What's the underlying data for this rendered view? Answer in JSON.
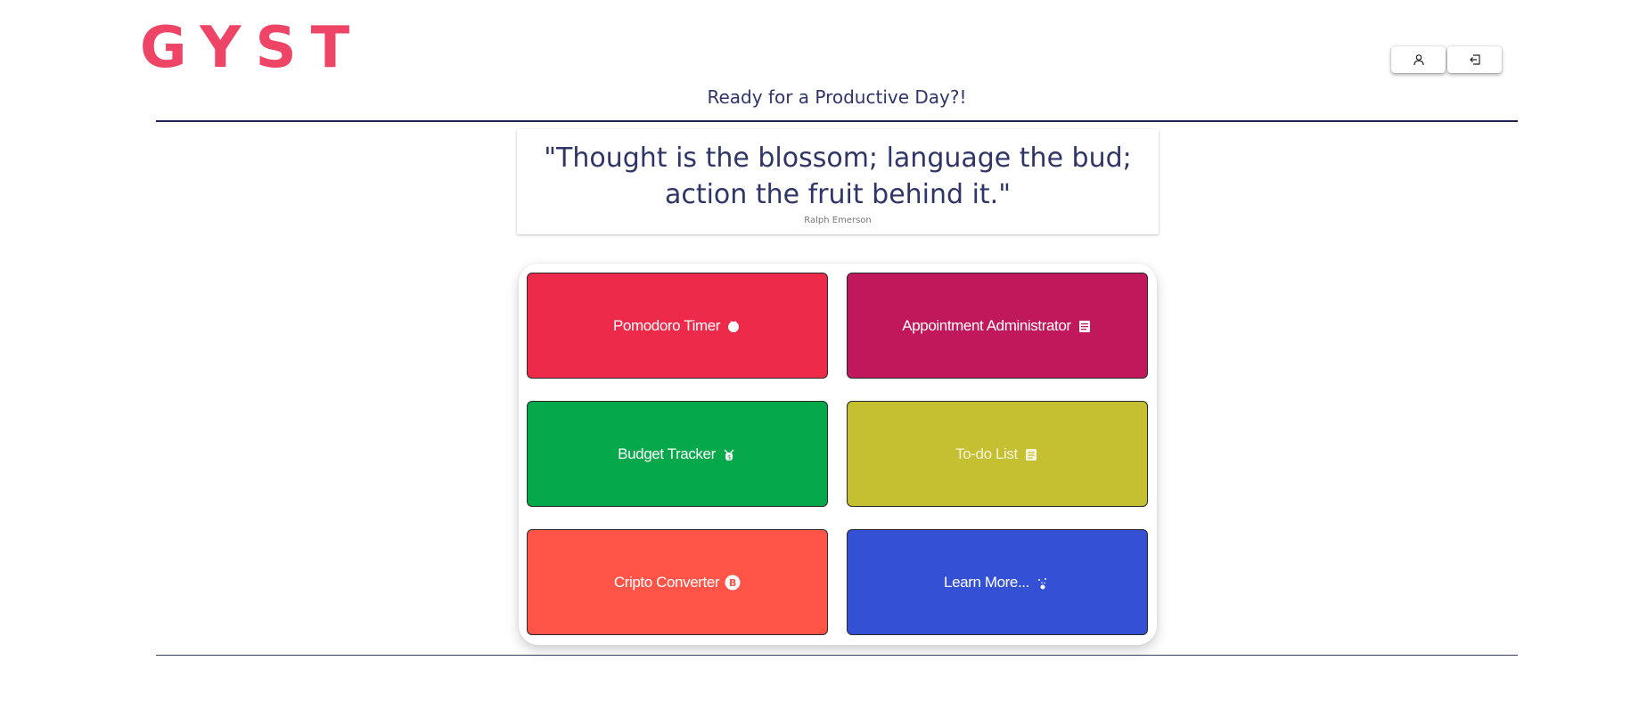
{
  "header": {
    "logo": "GYST",
    "greeting": "Ready for a Productive Day?!"
  },
  "actions": [
    {
      "name": "profile-button",
      "icon": "user-icon"
    },
    {
      "name": "logout-button",
      "icon": "logout-icon"
    }
  ],
  "quote": {
    "text": "\"Thought is the blossom; language the bud; action the fruit behind it.\"",
    "author": "Ralph Emerson"
  },
  "tiles": [
    {
      "label": "Pomodoro Timer",
      "icon": "tomato-icon",
      "bg": "#ee2a4a",
      "fg": "#ffffff"
    },
    {
      "label": "Appointment Administrator",
      "icon": "calendar-icon",
      "bg": "#c0185a",
      "fg": "#ffffff"
    },
    {
      "label": "Budget Tracker",
      "icon": "money-icon",
      "bg": "#05a84a",
      "fg": "#ffffff"
    },
    {
      "label": "To-do List",
      "icon": "clipboard-icon",
      "bg": "#c5bf32",
      "fg": "#f5f3d8"
    },
    {
      "label": "Cripto Converter",
      "icon": "bitcoin-icon",
      "bg": "#ff5447",
      "fg": "#ffffff"
    },
    {
      "label": "Learn More...",
      "icon": "sparkle-icon",
      "bg": "#3450d4",
      "fg": "#ffffff"
    }
  ]
}
